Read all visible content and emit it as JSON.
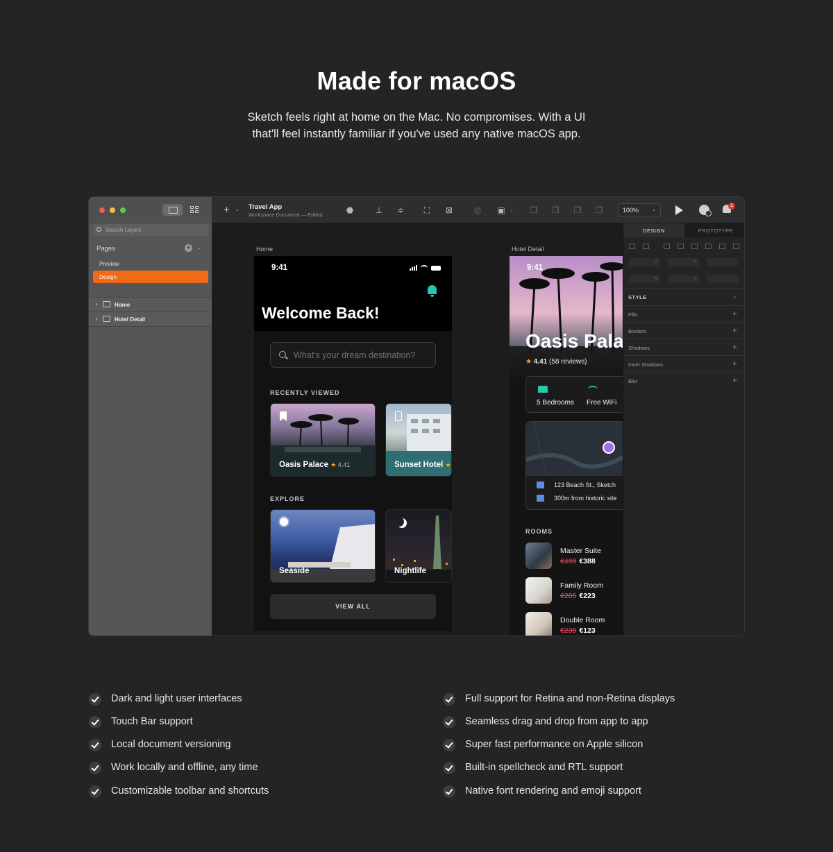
{
  "hero": {
    "title": "Made for macOS",
    "subtitle": "Sketch feels right at home on the Mac. No compromises. With a UI that'll feel instantly familiar if you've used any native macOS app."
  },
  "sidebar": {
    "search_placeholder": "Search Layers",
    "pages_label": "Pages",
    "pages": [
      {
        "label": "Preview",
        "active": false
      },
      {
        "label": "Design",
        "active": true
      }
    ],
    "layers": [
      {
        "label": "Home"
      },
      {
        "label": "Hotel Detail"
      }
    ]
  },
  "toolbar": {
    "doc_title": "Travel App",
    "doc_subtitle": "Workspace Document — Edited",
    "zoom": "100%",
    "notification_count": "1"
  },
  "canvas": {
    "artboards": [
      {
        "label": "Home"
      },
      {
        "label": "Hotel Detail"
      }
    ]
  },
  "home_screen": {
    "time": "9:41",
    "title": "Welcome Back!",
    "search_placeholder": "What's your dream destination?",
    "recently_viewed_label": "RECENTLY VIEWED",
    "recently_viewed": [
      {
        "name": "Oasis Palace",
        "rating": "4.41"
      },
      {
        "name": "Sunset Hotel",
        "rating": ""
      }
    ],
    "explore_label": "EXPLORE",
    "explore": [
      {
        "name": "Seaside"
      },
      {
        "name": "Nightlife"
      }
    ],
    "view_all_label": "VIEW ALL"
  },
  "detail_screen": {
    "time": "9:41",
    "hotel_name": "Oasis Palace",
    "rating": "4.41",
    "reviews": "(58 reviews)",
    "amenities": [
      {
        "label": "5 Bedrooms",
        "icon": "bed-icon"
      },
      {
        "label": "Free WiFi",
        "icon": "wifi-icon"
      }
    ],
    "address": "123 Beach St., Sketch",
    "landmark": "300m from historic site",
    "rooms_label": "ROOMS",
    "rooms": [
      {
        "name": "Master Suite",
        "old_price": "€499",
        "price": "€388"
      },
      {
        "name": "Family Room",
        "old_price": "€285",
        "price": "€223"
      },
      {
        "name": "Double Room",
        "old_price": "€235",
        "price": "€123"
      }
    ]
  },
  "inspector": {
    "tabs": [
      {
        "label": "DESIGN",
        "active": true
      },
      {
        "label": "PROTOTYPE",
        "active": false
      }
    ],
    "field_labels": [
      "X",
      "Y",
      "W",
      "H"
    ],
    "style_label": "STYLE",
    "properties": [
      "Fills",
      "Borders",
      "Shadows",
      "Inner Shadows",
      "Blur"
    ]
  },
  "features": {
    "left": [
      "Dark and light user interfaces",
      "Touch Bar support",
      "Local document versioning",
      "Work locally and offline, any time",
      "Customizable toolbar and shortcuts"
    ],
    "right": [
      "Full support for Retina and non-Retina displays",
      "Seamless drag and drop from app to app",
      "Super fast performance on Apple silicon",
      "Built-in spellcheck and RTL support",
      "Native font rendering and emoji support"
    ]
  },
  "colors": {
    "background": "#242426",
    "accent": "#f16a16",
    "teal": "#29c7ac",
    "price_strike": "#e04a62",
    "star": "#f0a927"
  }
}
